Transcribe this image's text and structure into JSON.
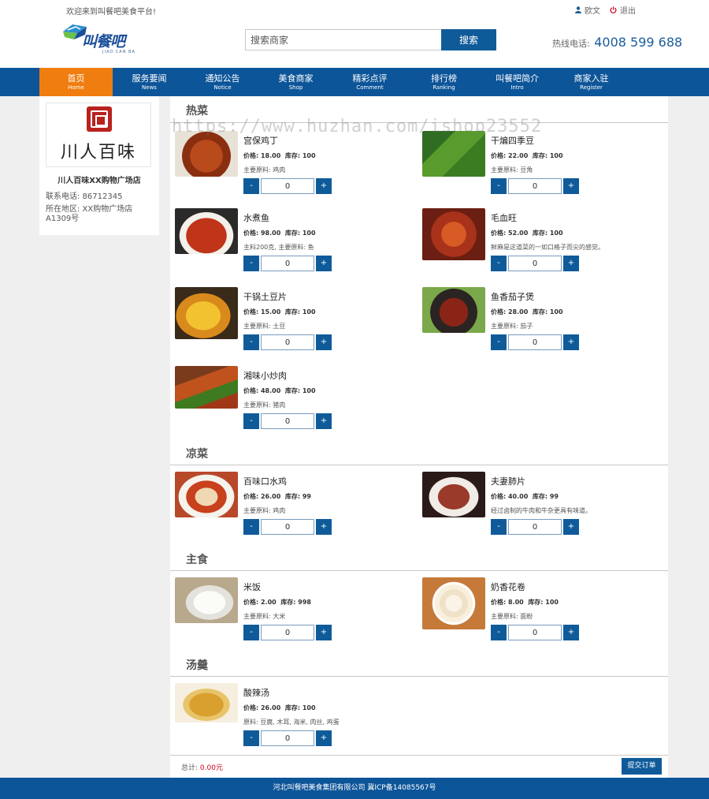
{
  "topbar": {
    "welcome": "欢迎来到叫餐吧美食平台!",
    "user_name": "欧文",
    "logout": "退出"
  },
  "header": {
    "logo_text": "叫餐吧",
    "logo_sub": "JIAO CAN BA",
    "search_placeholder": "搜索商家",
    "search_button": "搜索",
    "hotline_label": "热线电话:",
    "hotline_number": "4008 599 688"
  },
  "nav": [
    {
      "zh": "首页",
      "en": "Home",
      "active": true
    },
    {
      "zh": "服务要闻",
      "en": "News",
      "active": false
    },
    {
      "zh": "通知公告",
      "en": "Notice",
      "active": false
    },
    {
      "zh": "美食商家",
      "en": "Shop",
      "active": false
    },
    {
      "zh": "精彩点评",
      "en": "Comment",
      "active": false
    },
    {
      "zh": "排行榜",
      "en": "Ranking",
      "active": false
    },
    {
      "zh": "叫餐吧简介",
      "en": "Intro",
      "active": false
    },
    {
      "zh": "商家入驻",
      "en": "Register",
      "active": false
    }
  ],
  "shop": {
    "logo_text": "川人百味",
    "name": "川人百味XX购物广场店",
    "phone": "联系电话: 86712345",
    "address": "所在地区: XX购物广场店A1309号"
  },
  "categories": [
    {
      "title": "热菜",
      "dishes": [
        {
          "name": "宫保鸡丁",
          "price": "价格: 18.00",
          "stock": "库存: 100",
          "desc": "主要原料: 鸡肉",
          "qty": "0"
        },
        {
          "name": "干煸四季豆",
          "price": "价格: 22.00",
          "stock": "库存: 100",
          "desc": "主要原料: 豆角",
          "qty": "0"
        },
        {
          "name": "水煮鱼",
          "price": "价格: 98.00",
          "stock": "库存: 100",
          "desc": "主料200克, 主要原料: 鱼",
          "qty": "0"
        },
        {
          "name": "毛血旺",
          "price": "价格: 52.00",
          "stock": "库存: 100",
          "desc": "鲜麻是这道菜的一如口格子而尖的感觉。",
          "qty": "0"
        },
        {
          "name": "干锅土豆片",
          "price": "价格: 15.00",
          "stock": "库存: 100",
          "desc": "主要原料: 土豆",
          "qty": "0"
        },
        {
          "name": "鱼香茄子煲",
          "price": "价格: 28.00",
          "stock": "库存: 100",
          "desc": "主要原料: 茄子",
          "qty": "0"
        },
        {
          "name": "湘味小炒肉",
          "price": "价格: 48.00",
          "stock": "库存: 100",
          "desc": "主要原料: 猪肉",
          "qty": "0"
        }
      ]
    },
    {
      "title": "凉菜",
      "dishes": [
        {
          "name": "百味口水鸡",
          "price": "价格: 26.00",
          "stock": "库存: 99",
          "desc": "主要原料: 鸡肉",
          "qty": "0"
        },
        {
          "name": "夫妻肺片",
          "price": "价格: 40.00",
          "stock": "库存: 99",
          "desc": "经过卤制的牛肉和牛杂更具有味道。",
          "qty": "0"
        }
      ]
    },
    {
      "title": "主食",
      "dishes": [
        {
          "name": "米饭",
          "price": "价格: 2.00",
          "stock": "库存: 998",
          "desc": "主要原料: 大米",
          "qty": "0"
        },
        {
          "name": "奶香花卷",
          "price": "价格: 8.00",
          "stock": "库存: 100",
          "desc": "主要原料: 面粉",
          "qty": "0"
        }
      ]
    },
    {
      "title": "汤羹",
      "dishes": [
        {
          "name": "酸辣汤",
          "price": "价格: 26.00",
          "stock": "库存: 100",
          "desc": "原料: 豆腐, 木耳, 海米, 肉丝, 鸡蛋",
          "qty": "0"
        }
      ]
    }
  ],
  "cart": {
    "total_label": "总计:",
    "total_value": "0.00元",
    "submit": "提交订单"
  },
  "footer": "河北叫餐吧美食集团有限公司 冀ICP备14085567号",
  "watermark": "https://www.huzhan.com/ishop23552",
  "colors": {
    "brand_blue": "#0d5599",
    "active_orange": "#f07d10",
    "price_red": "#d0021b"
  }
}
